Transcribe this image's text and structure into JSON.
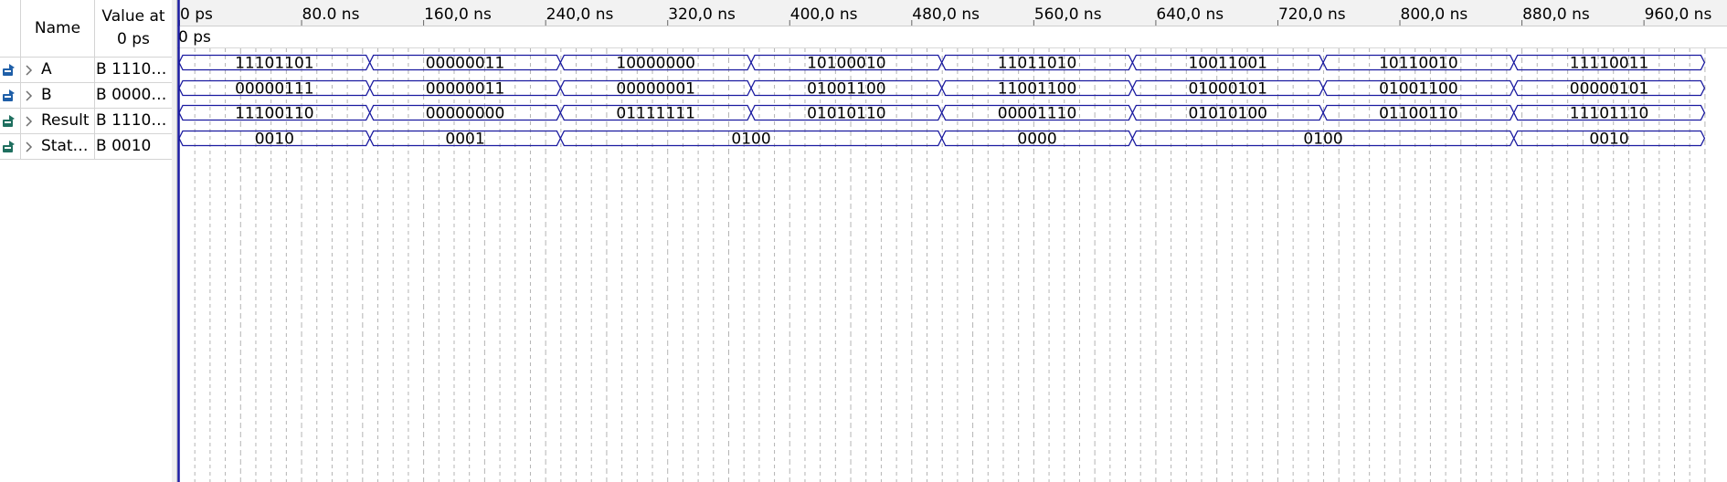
{
  "columns": {
    "name": "Name",
    "value": "Value at\n0 ps"
  },
  "signals": [
    {
      "name": "A",
      "value": "B 1110…",
      "kind": "input"
    },
    {
      "name": "B",
      "value": "B 0000…",
      "kind": "input"
    },
    {
      "name": "Result",
      "value": "B 1110…",
      "kind": "output"
    },
    {
      "name": "Stat…",
      "value": "B 0010",
      "kind": "output"
    }
  ],
  "timeline": {
    "ticks": [
      "0 ps",
      "80.0 ns",
      "160,0 ns",
      "240,0 ns",
      "320,0 ns",
      "400,0 ns",
      "480,0 ns",
      "560,0 ns",
      "640,0 ns",
      "720,0 ns",
      "800,0 ns",
      "880,0 ns",
      "960,0 ns"
    ],
    "cursor_label": "0 ps",
    "range_ns": [
      0,
      1000
    ]
  },
  "waveforms": [
    {
      "signal": "A",
      "segments": [
        {
          "from": 0,
          "to": 125,
          "label": "11101101"
        },
        {
          "from": 125,
          "to": 250,
          "label": "00000011"
        },
        {
          "from": 250,
          "to": 375,
          "label": "10000000"
        },
        {
          "from": 375,
          "to": 500,
          "label": "10100010"
        },
        {
          "from": 500,
          "to": 625,
          "label": "11011010"
        },
        {
          "from": 625,
          "to": 750,
          "label": "10011001"
        },
        {
          "from": 750,
          "to": 875,
          "label": "10110010"
        },
        {
          "from": 875,
          "to": 1000,
          "label": "11110011"
        }
      ]
    },
    {
      "signal": "B",
      "segments": [
        {
          "from": 0,
          "to": 125,
          "label": "00000111"
        },
        {
          "from": 125,
          "to": 250,
          "label": "00000011"
        },
        {
          "from": 250,
          "to": 375,
          "label": "00000001"
        },
        {
          "from": 375,
          "to": 500,
          "label": "01001100"
        },
        {
          "from": 500,
          "to": 625,
          "label": "11001100"
        },
        {
          "from": 625,
          "to": 750,
          "label": "01000101"
        },
        {
          "from": 750,
          "to": 875,
          "label": "01001100"
        },
        {
          "from": 875,
          "to": 1000,
          "label": "00000101"
        }
      ]
    },
    {
      "signal": "Result",
      "segments": [
        {
          "from": 0,
          "to": 125,
          "label": "11100110"
        },
        {
          "from": 125,
          "to": 250,
          "label": "00000000"
        },
        {
          "from": 250,
          "to": 375,
          "label": "01111111"
        },
        {
          "from": 375,
          "to": 500,
          "label": "01010110"
        },
        {
          "from": 500,
          "to": 625,
          "label": "00001110"
        },
        {
          "from": 625,
          "to": 750,
          "label": "01010100"
        },
        {
          "from": 750,
          "to": 875,
          "label": "01100110"
        },
        {
          "from": 875,
          "to": 1000,
          "label": "11101110"
        }
      ]
    },
    {
      "signal": "Stat…",
      "segments": [
        {
          "from": 0,
          "to": 125,
          "label": "0010"
        },
        {
          "from": 125,
          "to": 250,
          "label": "0001"
        },
        {
          "from": 250,
          "to": 500,
          "label": "0100"
        },
        {
          "from": 500,
          "to": 625,
          "label": "0000"
        },
        {
          "from": 625,
          "to": 875,
          "label": "0100"
        },
        {
          "from": 875,
          "to": 1000,
          "label": "0010"
        }
      ]
    }
  ],
  "colors": {
    "wave": "#1a1aa0",
    "grid": "#b4b4b4",
    "cursor": "#1a1aa0",
    "input_icon": "#1f5fa8",
    "output_icon": "#1f6f5f"
  }
}
